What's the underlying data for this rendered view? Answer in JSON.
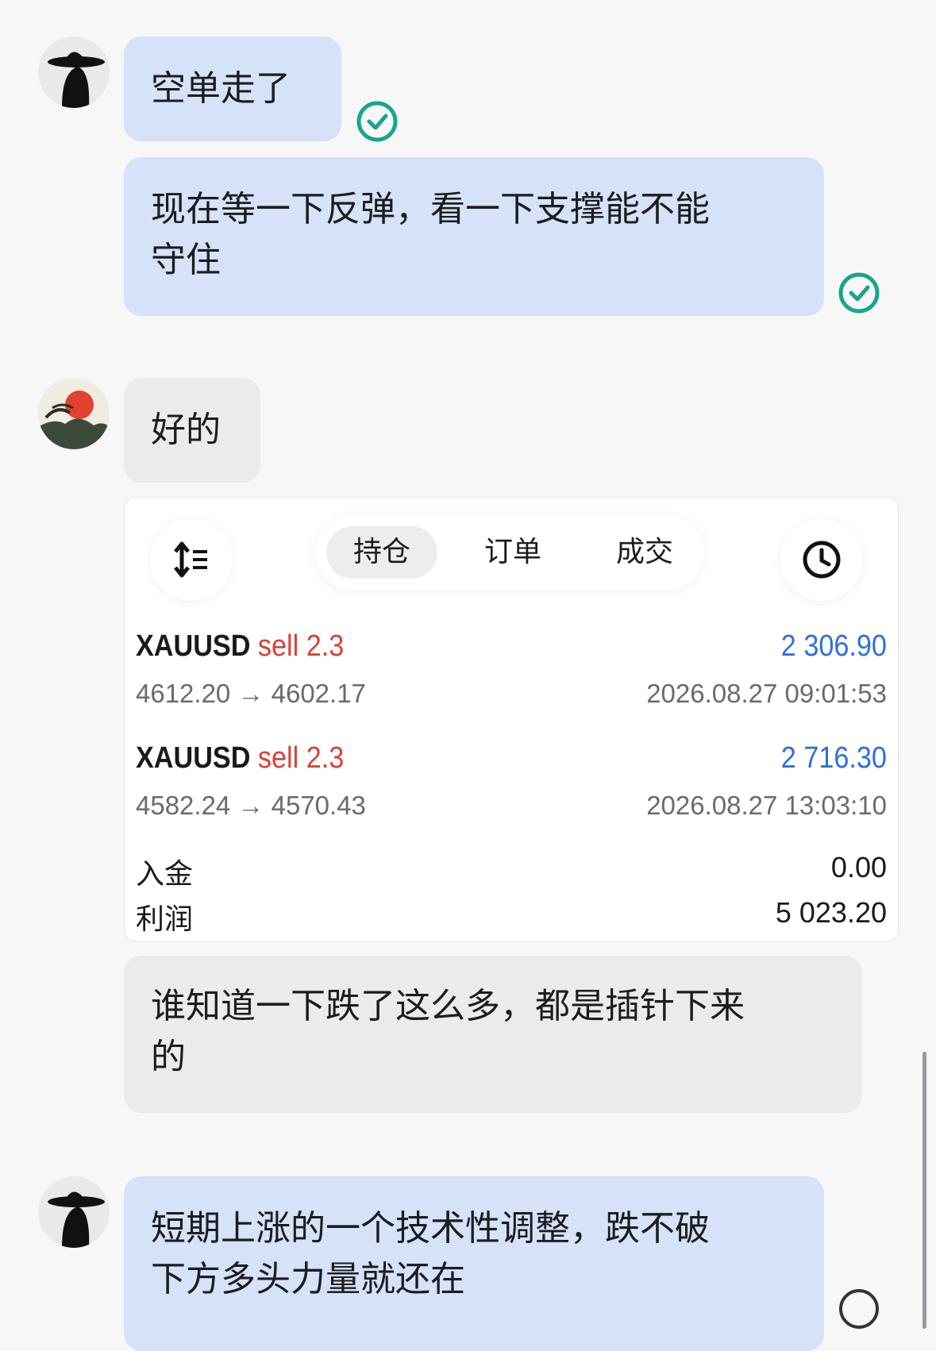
{
  "messages": [
    {
      "text": "空单走了",
      "status": "read"
    },
    {
      "text_line1": "现在等一下反弹，看一下支撑能不能",
      "text_line2": "守住",
      "status": "read"
    },
    {
      "text": "好的"
    },
    {
      "text_line1": "谁知道一下跌了这么多，都是插针下来",
      "text_line2": "的"
    },
    {
      "text_line1": "短期上涨的一个技术性调整，跌不破",
      "text_line2": "下方多头力量就还在",
      "status": "pending"
    }
  ],
  "trade_card": {
    "tabs": [
      "持仓",
      "订单",
      "成交"
    ],
    "active_tab": "持仓",
    "sort_icon": "sort-list-icon",
    "history_icon": "clock-icon",
    "trades": [
      {
        "symbol": "XAUUSD",
        "direction": "sell",
        "lots": "2.3",
        "profit": "2 306.90",
        "prices": "4612.20 → 4602.17",
        "time": "2026.08.27 09:01:53"
      },
      {
        "symbol": "XAUUSD",
        "direction": "sell",
        "lots": "2.3",
        "profit": "2 716.30",
        "prices": "4582.24 → 4570.43",
        "time": "2026.08.27 13:03:10"
      }
    ],
    "summary": [
      {
        "label": "入金",
        "value": "0.00"
      },
      {
        "label": "利润",
        "value": "5 023.20"
      }
    ]
  },
  "colors": {
    "outgoing_bubble": "#d5e2f8",
    "incoming_bubble": "#ebebee",
    "check_green": "#1aa58a",
    "sell_red": "#d9403a",
    "profit_blue": "#2f6fdb"
  }
}
